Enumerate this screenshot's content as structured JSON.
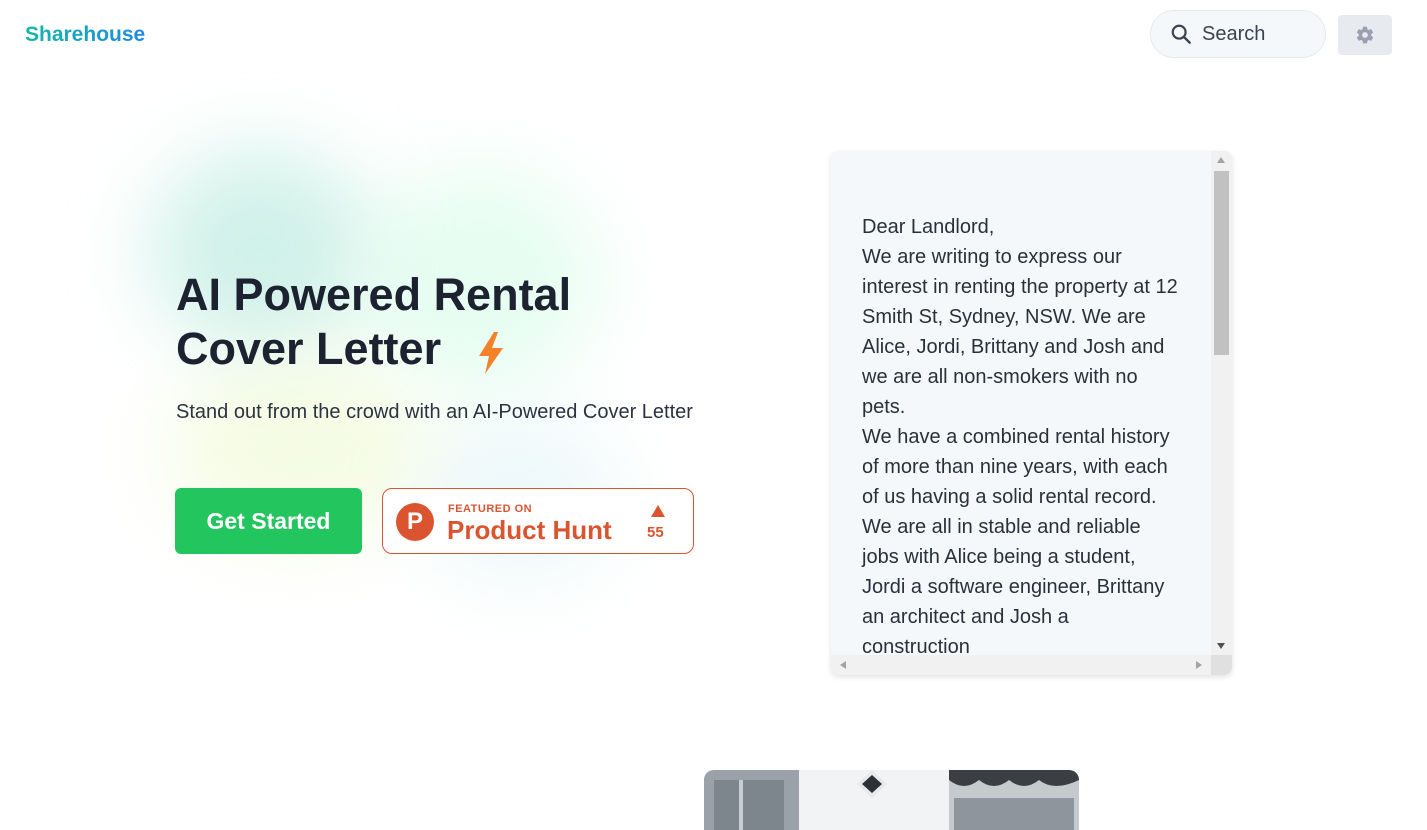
{
  "header": {
    "logo": "Sharehouse",
    "search_label": "Search",
    "search_icon": "search-icon",
    "settings_icon": "gear-icon"
  },
  "hero": {
    "title_line1": "AI Powered Rental",
    "title_line2": "Cover Letter",
    "title_icon": "lightning-bolt-icon",
    "subtitle": "Stand out from the crowd with an AI-Powered Cover Letter",
    "cta_label": "Get Started"
  },
  "product_hunt": {
    "featured_label": "FEATURED ON",
    "name": "Product Hunt",
    "logo_letter": "P",
    "upvotes": "55"
  },
  "letter": {
    "text": "Dear Landlord,\nWe are writing to express our interest in renting the property at 12 Smith St, Sydney, NSW. We are Alice, Jordi, Brittany and Josh and we are all non-smokers with no pets.\nWe have a combined rental history of more than nine years, with each of us having a solid rental record. We are all in stable and reliable jobs with Alice being a student, Jordi a software engineer, Brittany an architect and Josh a construction"
  },
  "colors": {
    "accent_green": "#22c55e",
    "product_hunt": "#da552f",
    "bolt": "#f5822a"
  }
}
